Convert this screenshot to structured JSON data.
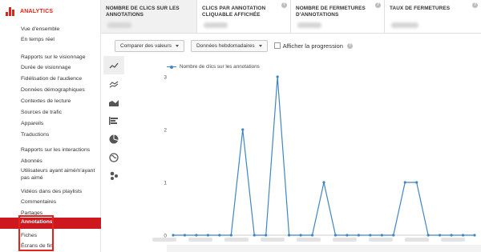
{
  "brand": {
    "name": "ANALYTICS",
    "color": "#e62117"
  },
  "sidebar": {
    "items": [
      {
        "label": "Vue d'ensemble",
        "type": "link"
      },
      {
        "label": "En temps réel",
        "type": "link"
      },
      {
        "label": "Rapports sur le visionnage",
        "type": "header"
      },
      {
        "label": "Durée de visionnage",
        "type": "link"
      },
      {
        "label": "Fidélisation de l'audience",
        "type": "link"
      },
      {
        "label": "Données démographiques",
        "type": "link"
      },
      {
        "label": "Contextes de lecture",
        "type": "link"
      },
      {
        "label": "Sources de trafic",
        "type": "link"
      },
      {
        "label": "Appareils",
        "type": "link"
      },
      {
        "label": "Traductions",
        "type": "link"
      },
      {
        "label": "Rapports sur les interactions",
        "type": "header"
      },
      {
        "label": "Abonnés",
        "type": "link"
      },
      {
        "label": "Utilisateurs ayant aimé/n'ayant pas aimé",
        "type": "link"
      },
      {
        "label": "Vidéos dans des playlists",
        "type": "link"
      },
      {
        "label": "Commentaires",
        "type": "link"
      },
      {
        "label": "Partages",
        "type": "link"
      },
      {
        "label": "Annotations",
        "type": "link",
        "active": true
      },
      {
        "label": "Fiches",
        "type": "link"
      },
      {
        "label": "Écrans de fin",
        "type": "link"
      }
    ]
  },
  "tabs": [
    {
      "label": "NOMBRE DE CLICS SUR LES ANNOTATIONS",
      "active": true,
      "help": false
    },
    {
      "label": "CLICS PAR ANNOTATION CLIQUABLE AFFICHÉE",
      "active": false,
      "help": true
    },
    {
      "label": "NOMBRE DE FERMETURES D'ANNOTATIONS",
      "active": false,
      "help": true
    },
    {
      "label": "TAUX DE FERMETURES",
      "active": false,
      "help": true
    }
  ],
  "toolbar": {
    "compare_label": "Comparer des valeurs",
    "period_label": "Données hebdomadaires",
    "progress_label": "Afficher la progression",
    "progress_checked": false
  },
  "chart_types": [
    {
      "icon": "line-chart-icon",
      "active": true
    },
    {
      "icon": "multi-line-chart-icon",
      "active": false
    },
    {
      "icon": "area-chart-icon",
      "active": false
    },
    {
      "icon": "bar-chart-icon",
      "active": false
    },
    {
      "icon": "pie-chart-icon",
      "active": false
    },
    {
      "icon": "globe-map-icon",
      "active": false
    },
    {
      "icon": "bubble-chart-icon",
      "active": false
    }
  ],
  "chart_data": {
    "type": "line",
    "series": [
      {
        "name": "Nombre de clics sur les annotations",
        "color": "#4285c5",
        "values": [
          0,
          0,
          0,
          0,
          0,
          0,
          2,
          0,
          0,
          3,
          0,
          0,
          0,
          1,
          0,
          0,
          0,
          0,
          0,
          0,
          1,
          1,
          0,
          0,
          0,
          0,
          0
        ]
      }
    ],
    "yticks": [
      0,
      1,
      2,
      3
    ],
    "ylim": [
      0,
      3
    ],
    "grid": true,
    "legend": "top-left"
  }
}
